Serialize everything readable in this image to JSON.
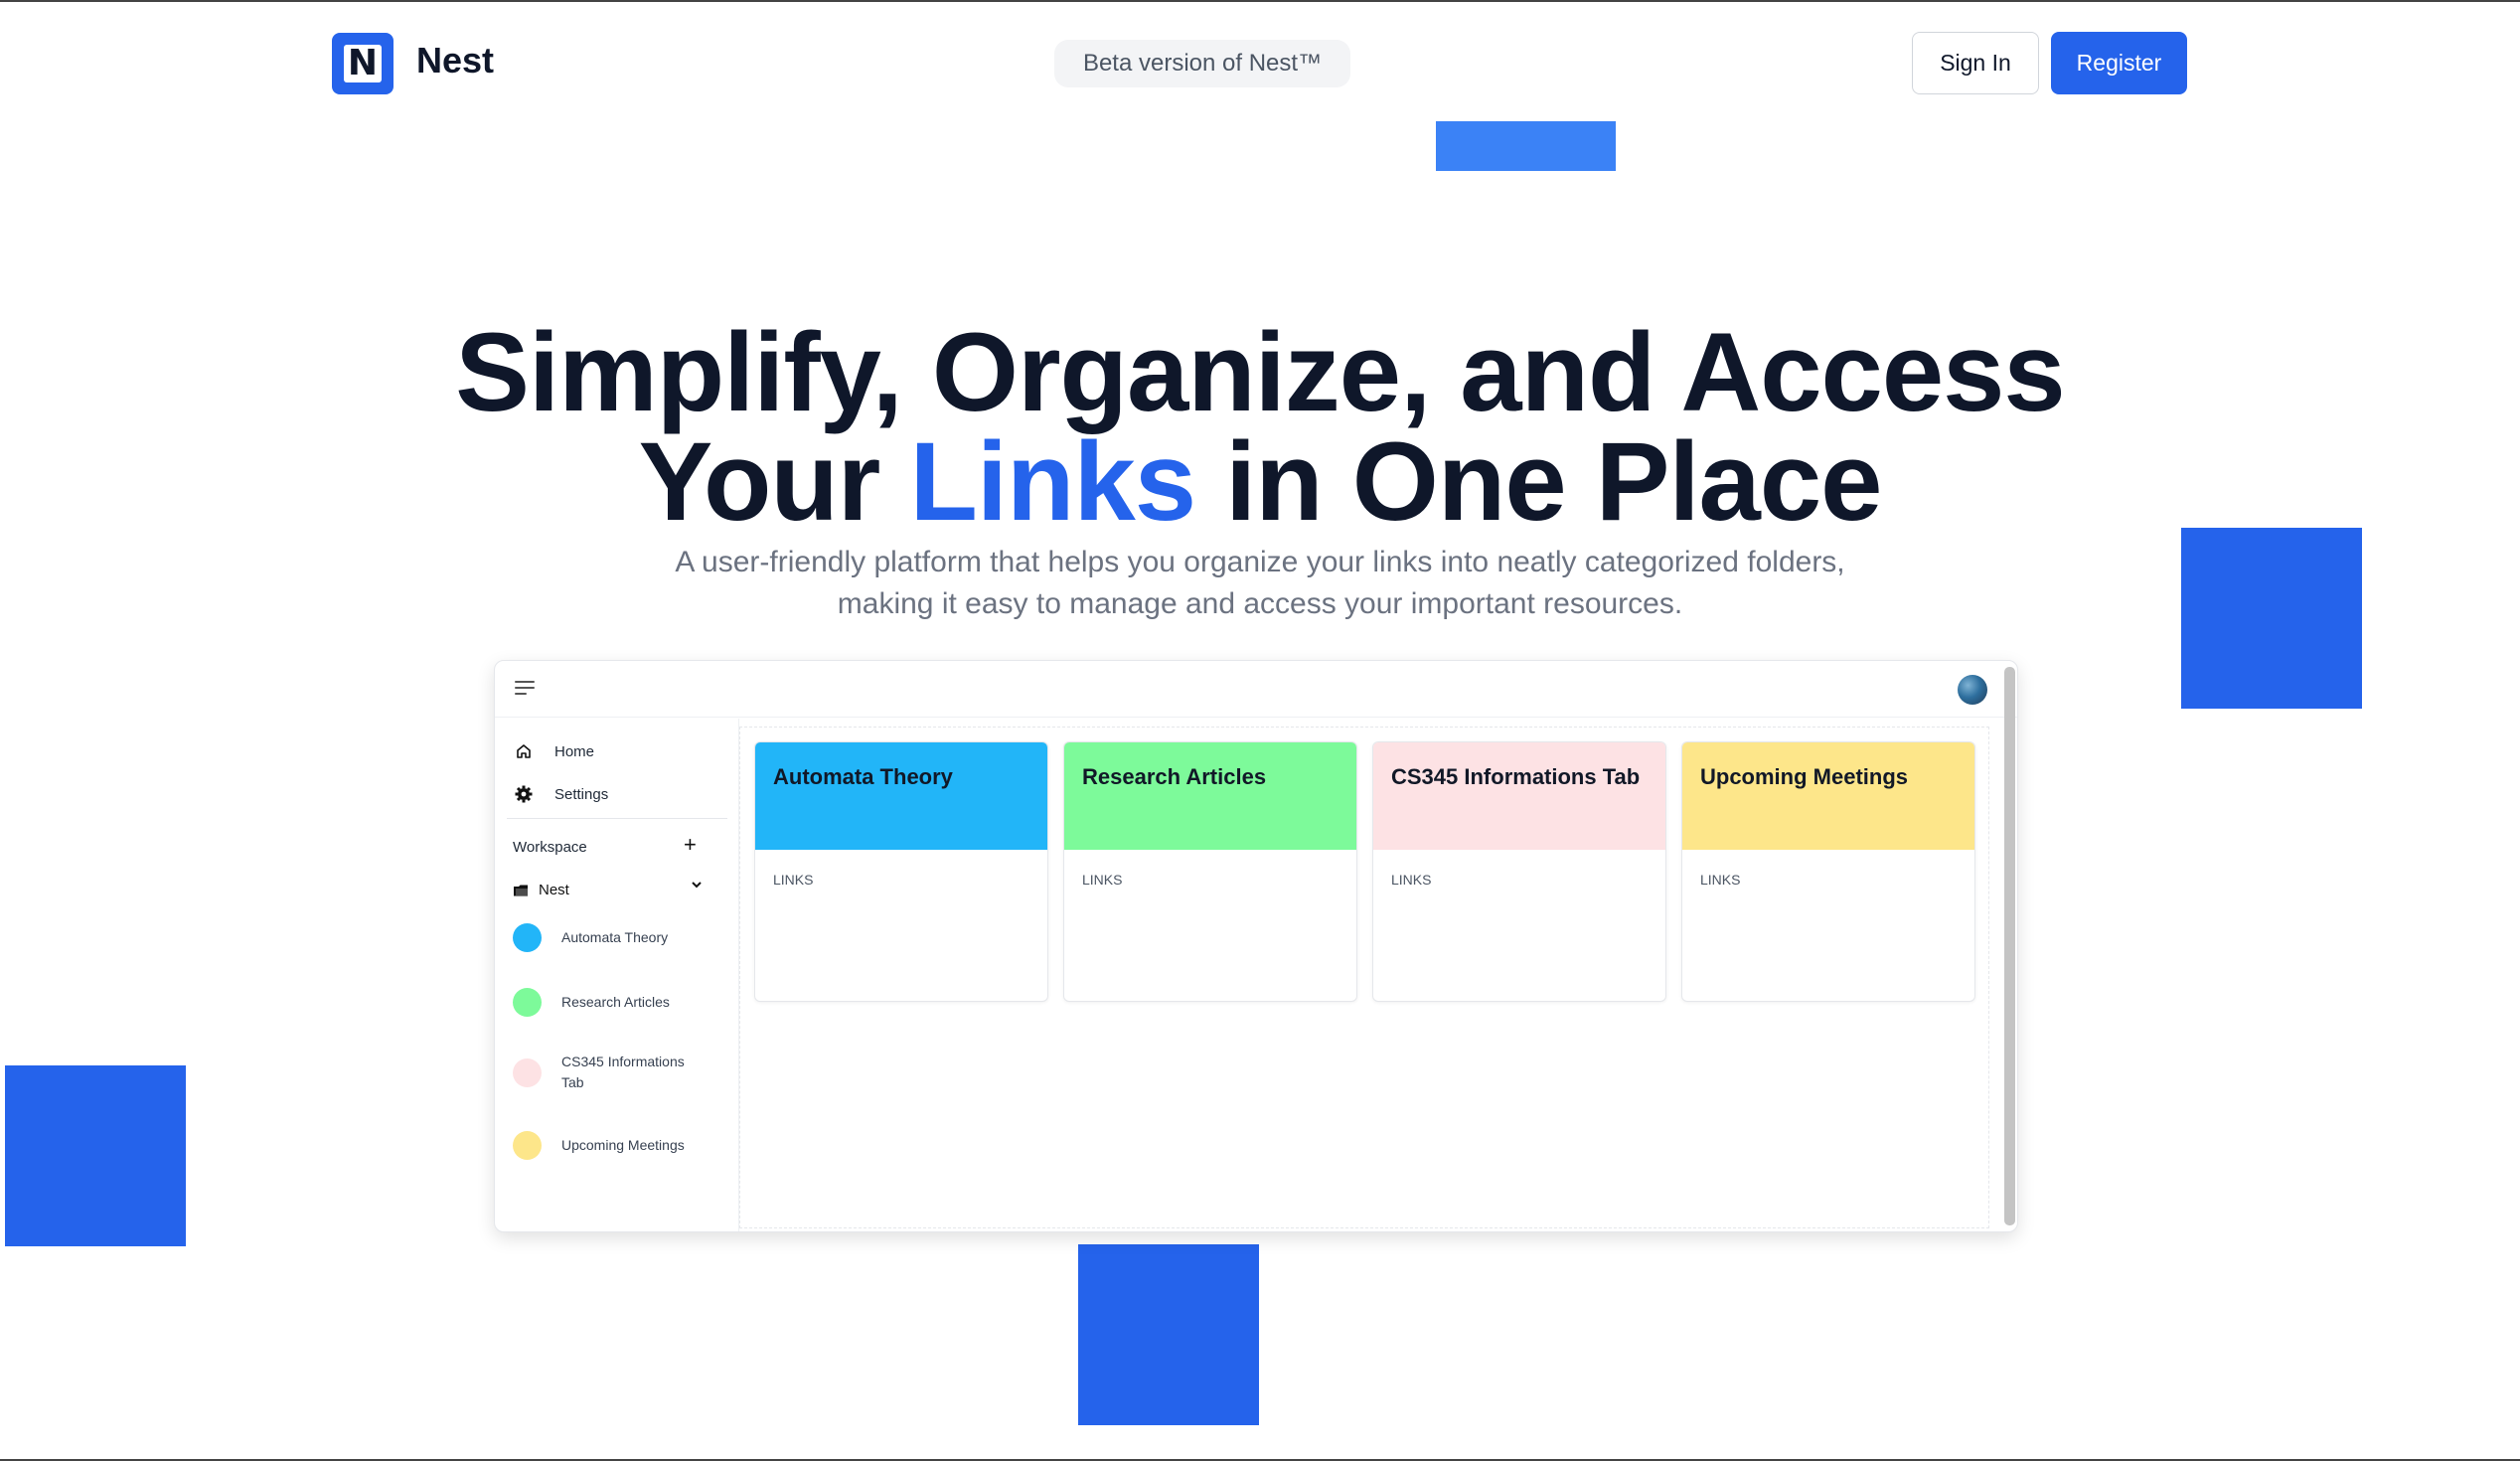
{
  "header": {
    "logo_letter": "N",
    "brand": "Nest",
    "beta_badge": "Beta version of Nest™",
    "signin_label": "Sign In",
    "register_label": "Register"
  },
  "hero": {
    "title_line1": "Simplify, Organize, and Access",
    "title_line2_before": "Your ",
    "title_line2_accent": "Links",
    "title_line2_after": " in One Place",
    "subtitle_line1": "A user-friendly platform that helps you organize your links into neatly categorized folders,",
    "subtitle_line2": "making it easy to manage and access your important resources."
  },
  "preview": {
    "sidebar": {
      "home": "Home",
      "settings": "Settings",
      "workspace": "Workspace",
      "workspace_name": "Nest",
      "folders": [
        {
          "name": "Automata Theory",
          "color": "#22b5f8"
        },
        {
          "name": "Research Articles",
          "color": "#7dfa9a"
        },
        {
          "name": "CS345 Informations Tab",
          "color": "#fde2e4"
        },
        {
          "name": "Upcoming Meetings",
          "color": "#fde68a"
        }
      ]
    },
    "cards": [
      {
        "title": "Automata Theory",
        "label": "LINKS",
        "color": "#22b5f8"
      },
      {
        "title": "Research Articles",
        "label": "LINKS",
        "color": "#7dfa9a"
      },
      {
        "title": "CS345 Informations Tab",
        "label": "LINKS",
        "color": "#fde2e4"
      },
      {
        "title": "Upcoming Meetings",
        "label": "LINKS",
        "color": "#fde68a"
      }
    ]
  },
  "colors": {
    "accent": "#2563eb",
    "text": "#0f172a",
    "muted": "#6b7280"
  }
}
